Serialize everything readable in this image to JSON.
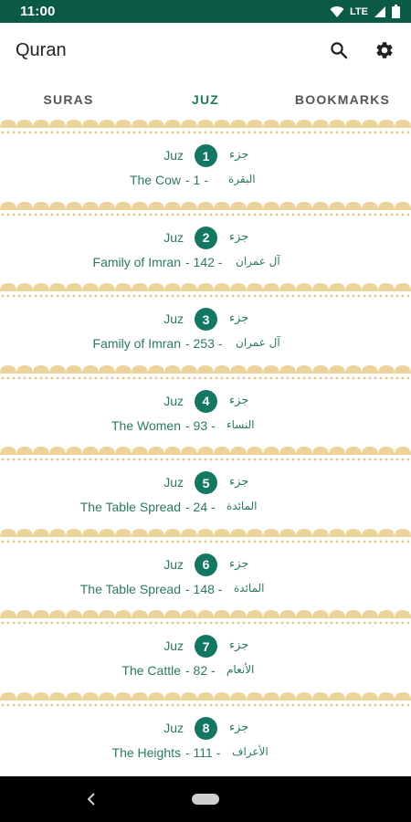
{
  "status_bar": {
    "time": "11:00",
    "network": "LTE",
    "icons": [
      "wifi-icon",
      "signal-icon",
      "battery-icon"
    ]
  },
  "app_bar": {
    "title": "Quran",
    "actions": [
      "search-icon",
      "settings-gear-icon"
    ]
  },
  "tabs": [
    {
      "label": "SURAS",
      "active": false
    },
    {
      "label": "JUZ",
      "active": true
    },
    {
      "label": "BOOKMARKS",
      "active": false
    }
  ],
  "juz_items": [
    {
      "label": "Juz",
      "number": "1",
      "label_ar": "جزء",
      "sura_en": "The Cow",
      "sura_num": " - 1 - ",
      "sura_ar": "البقرة"
    },
    {
      "label": "Juz",
      "number": "2",
      "label_ar": "جزء",
      "sura_en": "Family of Imran",
      "sura_num": " - 142 - ",
      "sura_ar": "آل عمران"
    },
    {
      "label": "Juz",
      "number": "3",
      "label_ar": "جزء",
      "sura_en": "Family of Imran",
      "sura_num": " - 253 - ",
      "sura_ar": "آل عمران"
    },
    {
      "label": "Juz",
      "number": "4",
      "label_ar": "جزء",
      "sura_en": "The Women",
      "sura_num": " - 93 - ",
      "sura_ar": "النساء"
    },
    {
      "label": "Juz",
      "number": "5",
      "label_ar": "جزء",
      "sura_en": "The Table Spread",
      "sura_num": " - 24 - ",
      "sura_ar": "المائدة"
    },
    {
      "label": "Juz",
      "number": "6",
      "label_ar": "جزء",
      "sura_en": "The Table Spread",
      "sura_num": " - 148 - ",
      "sura_ar": "المائدة"
    },
    {
      "label": "Juz",
      "number": "7",
      "label_ar": "جزء",
      "sura_en": "The Cattle",
      "sura_num": " - 82 - ",
      "sura_ar": "الأنعام"
    },
    {
      "label": "Juz",
      "number": "8",
      "label_ar": "جزء",
      "sura_en": "The Heights",
      "sura_num": " - 111 - ",
      "sura_ar": "الأعراف"
    }
  ],
  "colors": {
    "status_bar": "#0b5a44",
    "accent": "#137862",
    "text_green": "#2a7a62",
    "separator_gold": "#ecd39a"
  },
  "nav_bar": {
    "icons": [
      "back-icon",
      "home-pill-icon"
    ]
  }
}
